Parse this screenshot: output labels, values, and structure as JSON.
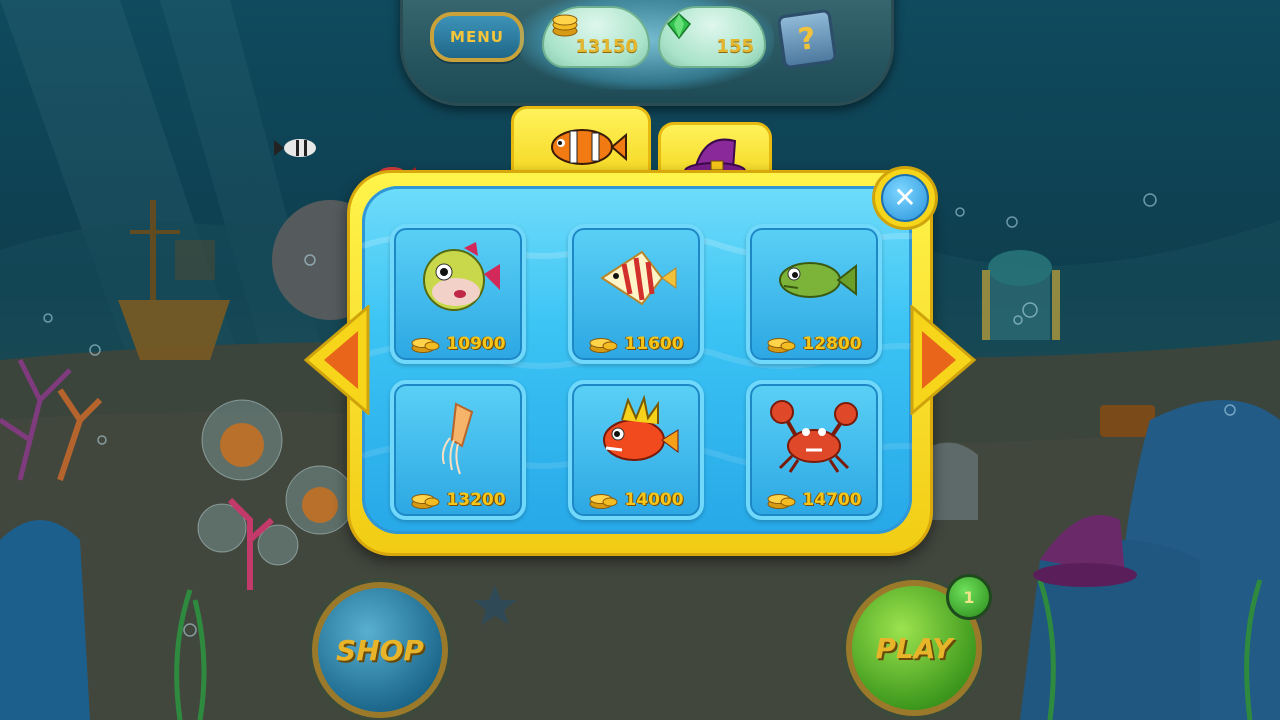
{
  "hud": {
    "menu_label": "MENU",
    "coins": "13150",
    "gems": "155",
    "help_label": "?"
  },
  "tabs": [
    {
      "name": "fish",
      "icon": "clownfish-icon",
      "active": true
    },
    {
      "name": "decor",
      "icon": "witch-hat-icon",
      "active": false
    }
  ],
  "shop_items": [
    {
      "name": "pufferfish",
      "price": "10900"
    },
    {
      "name": "butterflyfish",
      "price": "11600"
    },
    {
      "name": "green-fish",
      "price": "12800"
    },
    {
      "name": "jellyfish",
      "price": "13200"
    },
    {
      "name": "lionfish",
      "price": "14000"
    },
    {
      "name": "crab",
      "price": "14700"
    }
  ],
  "close_label": "✕",
  "buttons": {
    "shop_label": "SHOP",
    "play_label": "PLAY",
    "play_badge": "1"
  },
  "colors": {
    "panel_yellow": "#f7d51b",
    "panel_blue": "#3cc4f4",
    "price_gold": "#f5c518"
  }
}
